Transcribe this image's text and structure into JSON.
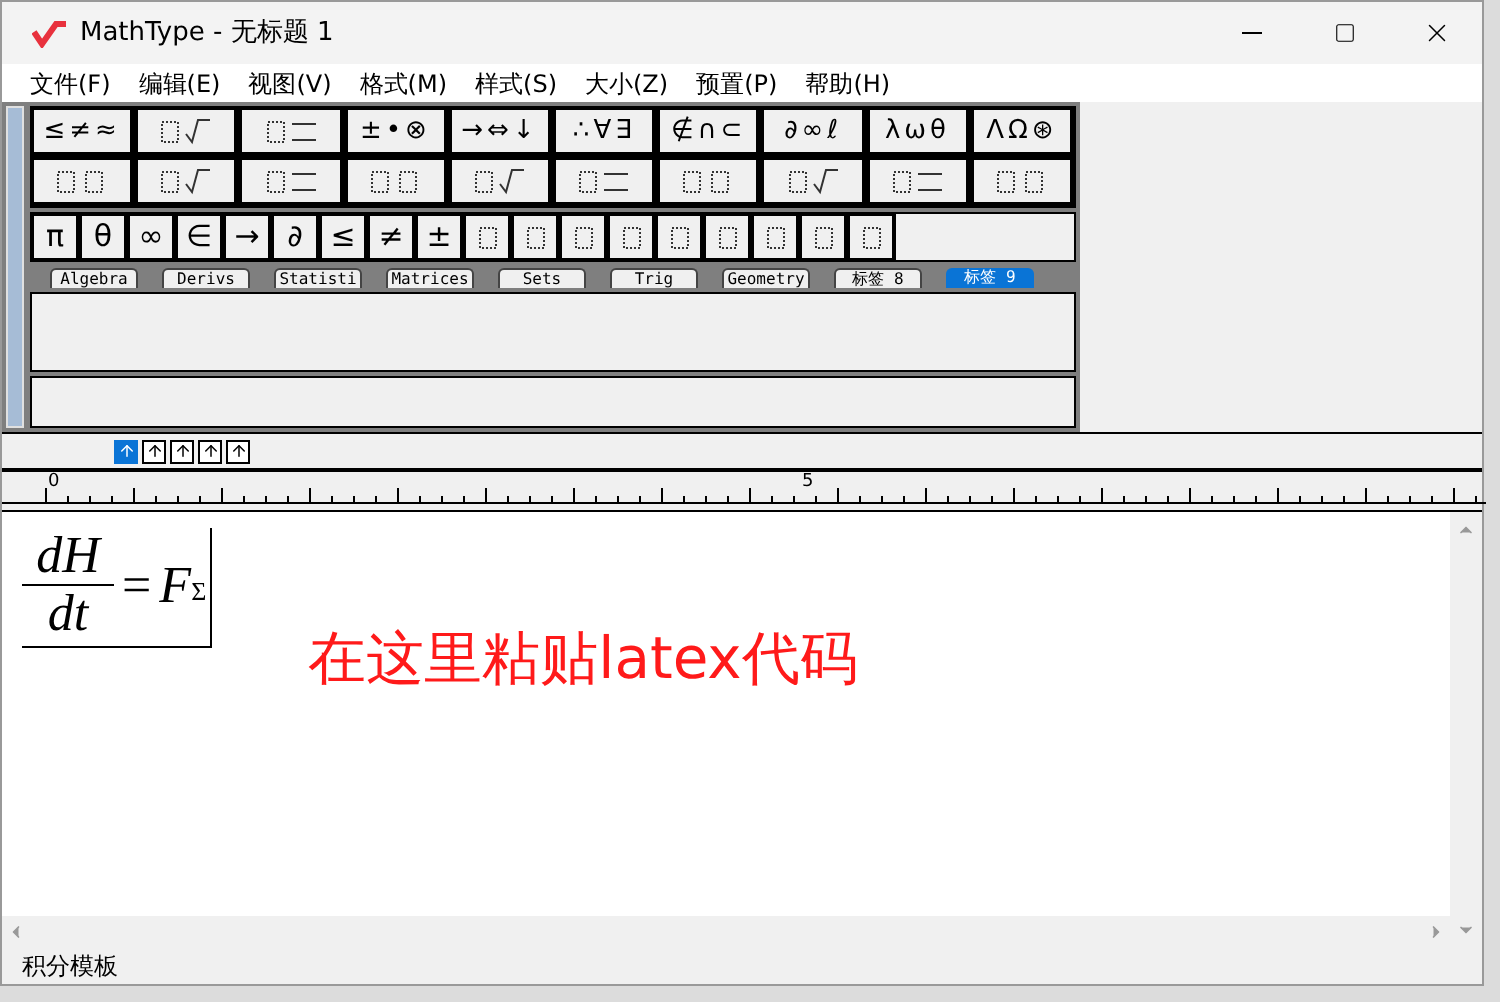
{
  "window": {
    "title": "MathType - 无标题 1"
  },
  "menu": [
    "文件(F)",
    "编辑(E)",
    "视图(V)",
    "格式(M)",
    "样式(S)",
    "大小(Z)",
    "预置(P)",
    "帮助(H)"
  ],
  "palette_row_1": [
    {
      "kind": "text",
      "label": "≤≠≈"
    },
    {
      "kind": "icon"
    },
    {
      "kind": "icon"
    },
    {
      "kind": "text",
      "label": "±•⊗"
    },
    {
      "kind": "text",
      "label": "→⇔↓"
    },
    {
      "kind": "text",
      "label": "∴∀∃"
    },
    {
      "kind": "text",
      "label": "∉∩⊂"
    },
    {
      "kind": "text",
      "label": "∂∞ℓ"
    },
    {
      "kind": "text",
      "label": "λωθ"
    },
    {
      "kind": "text",
      "label": "ΛΩ⊛"
    }
  ],
  "palette_row_2": [
    {
      "kind": "icon"
    },
    {
      "kind": "icon"
    },
    {
      "kind": "icon"
    },
    {
      "kind": "icon"
    },
    {
      "kind": "icon"
    },
    {
      "kind": "icon"
    },
    {
      "kind": "icon"
    },
    {
      "kind": "icon"
    },
    {
      "kind": "icon"
    },
    {
      "kind": "icon"
    }
  ],
  "small_bar": [
    {
      "kind": "text",
      "label": "π"
    },
    {
      "kind": "text",
      "label": "θ"
    },
    {
      "kind": "text",
      "label": "∞"
    },
    {
      "kind": "text",
      "label": "∈"
    },
    {
      "kind": "text",
      "label": "→"
    },
    {
      "kind": "text",
      "label": "∂"
    },
    {
      "kind": "text",
      "label": "≤"
    },
    {
      "kind": "text",
      "label": "≠"
    },
    {
      "kind": "text",
      "label": "±"
    },
    {
      "kind": "icon"
    },
    {
      "kind": "icon"
    },
    {
      "kind": "icon"
    },
    {
      "kind": "icon"
    },
    {
      "kind": "icon"
    },
    {
      "kind": "icon"
    },
    {
      "kind": "icon"
    },
    {
      "kind": "icon"
    },
    {
      "kind": "icon"
    }
  ],
  "tabs": [
    {
      "label": "Algebra",
      "selected": false
    },
    {
      "label": "Derivs",
      "selected": false
    },
    {
      "label": "Statisti",
      "selected": false
    },
    {
      "label": "Matrices",
      "selected": false
    },
    {
      "label": "Sets",
      "selected": false
    },
    {
      "label": "Trig",
      "selected": false
    },
    {
      "label": "Geometry",
      "selected": false
    },
    {
      "label": "标签 8",
      "selected": false
    },
    {
      "label": "标签 9",
      "selected": true
    }
  ],
  "nudge_buttons": [
    {
      "selected": true
    },
    {
      "selected": false
    },
    {
      "selected": false
    },
    {
      "selected": false
    },
    {
      "selected": false
    }
  ],
  "ruler": {
    "labels": [
      "0",
      "5"
    ]
  },
  "equation": {
    "numerator": "dH",
    "denominator": "dt",
    "operator": "=",
    "lhs": "F",
    "subscript": "Σ"
  },
  "annotation": "在这里粘贴latex代码",
  "status_bar": "积分模板"
}
